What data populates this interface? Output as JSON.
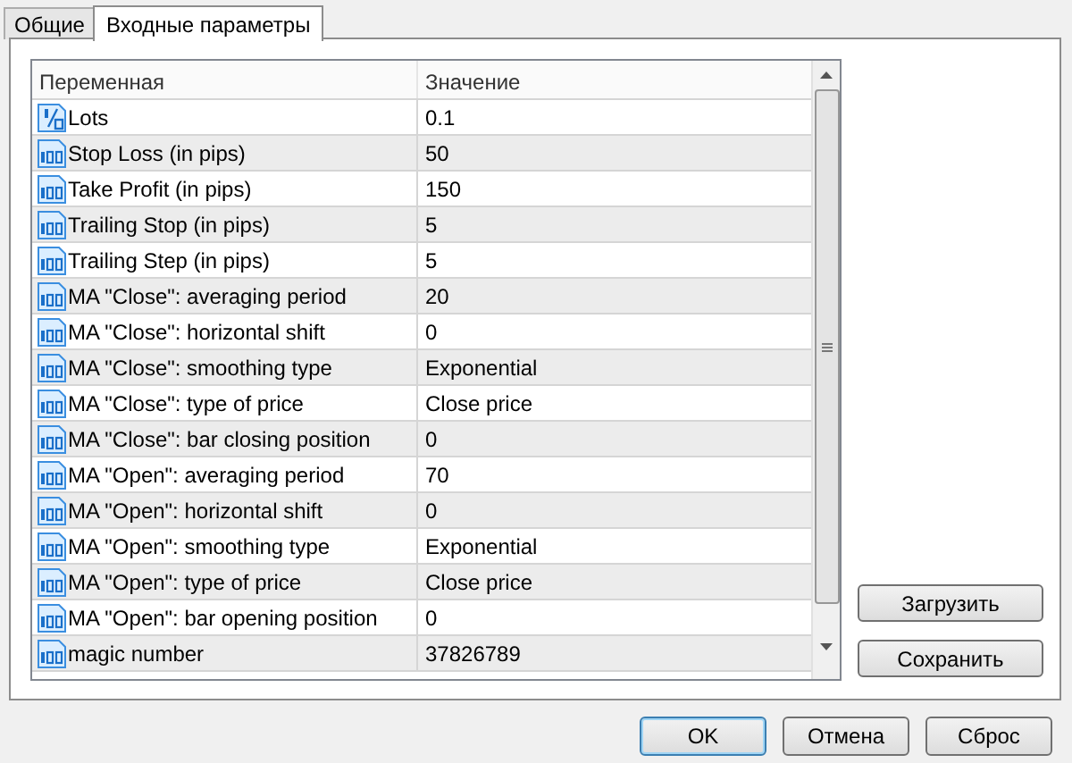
{
  "tabs": [
    {
      "label": "Общие",
      "selected": false
    },
    {
      "label": "Входные параметры",
      "selected": true
    }
  ],
  "table": {
    "columns": [
      "Переменная",
      "Значение"
    ],
    "rows": [
      {
        "kind": "fraction",
        "name": "Lots",
        "value": "0.1"
      },
      {
        "kind": "integer",
        "name": "Stop Loss (in pips)",
        "value": "50"
      },
      {
        "kind": "integer",
        "name": "Take Profit (in pips)",
        "value": "150"
      },
      {
        "kind": "integer",
        "name": "Trailing Stop (in pips)",
        "value": "5"
      },
      {
        "kind": "integer",
        "name": "Trailing Step (in pips)",
        "value": "5"
      },
      {
        "kind": "integer",
        "name": "MA \"Close\": averaging period",
        "value": "20"
      },
      {
        "kind": "integer",
        "name": "MA \"Close\": horizontal shift",
        "value": "0"
      },
      {
        "kind": "integer",
        "name": "MA \"Close\": smoothing type",
        "value": "Exponential"
      },
      {
        "kind": "integer",
        "name": "MA \"Close\": type of price",
        "value": "Close price"
      },
      {
        "kind": "integer",
        "name": "MA \"Close\": bar closing position",
        "value": "0"
      },
      {
        "kind": "integer",
        "name": "MA \"Open\": averaging period",
        "value": "70"
      },
      {
        "kind": "integer",
        "name": "MA \"Open\": horizontal shift",
        "value": "0"
      },
      {
        "kind": "integer",
        "name": "MA \"Open\": smoothing type",
        "value": "Exponential"
      },
      {
        "kind": "integer",
        "name": "MA \"Open\": type of price",
        "value": "Close price"
      },
      {
        "kind": "integer",
        "name": "MA \"Open\": bar opening position",
        "value": "0"
      },
      {
        "kind": "integer",
        "name": "magic number",
        "value": "37826789"
      }
    ]
  },
  "side_buttons": [
    "Загрузить",
    "Сохранить"
  ],
  "buttons": [
    "OK",
    "Отмена",
    "Сброс"
  ]
}
